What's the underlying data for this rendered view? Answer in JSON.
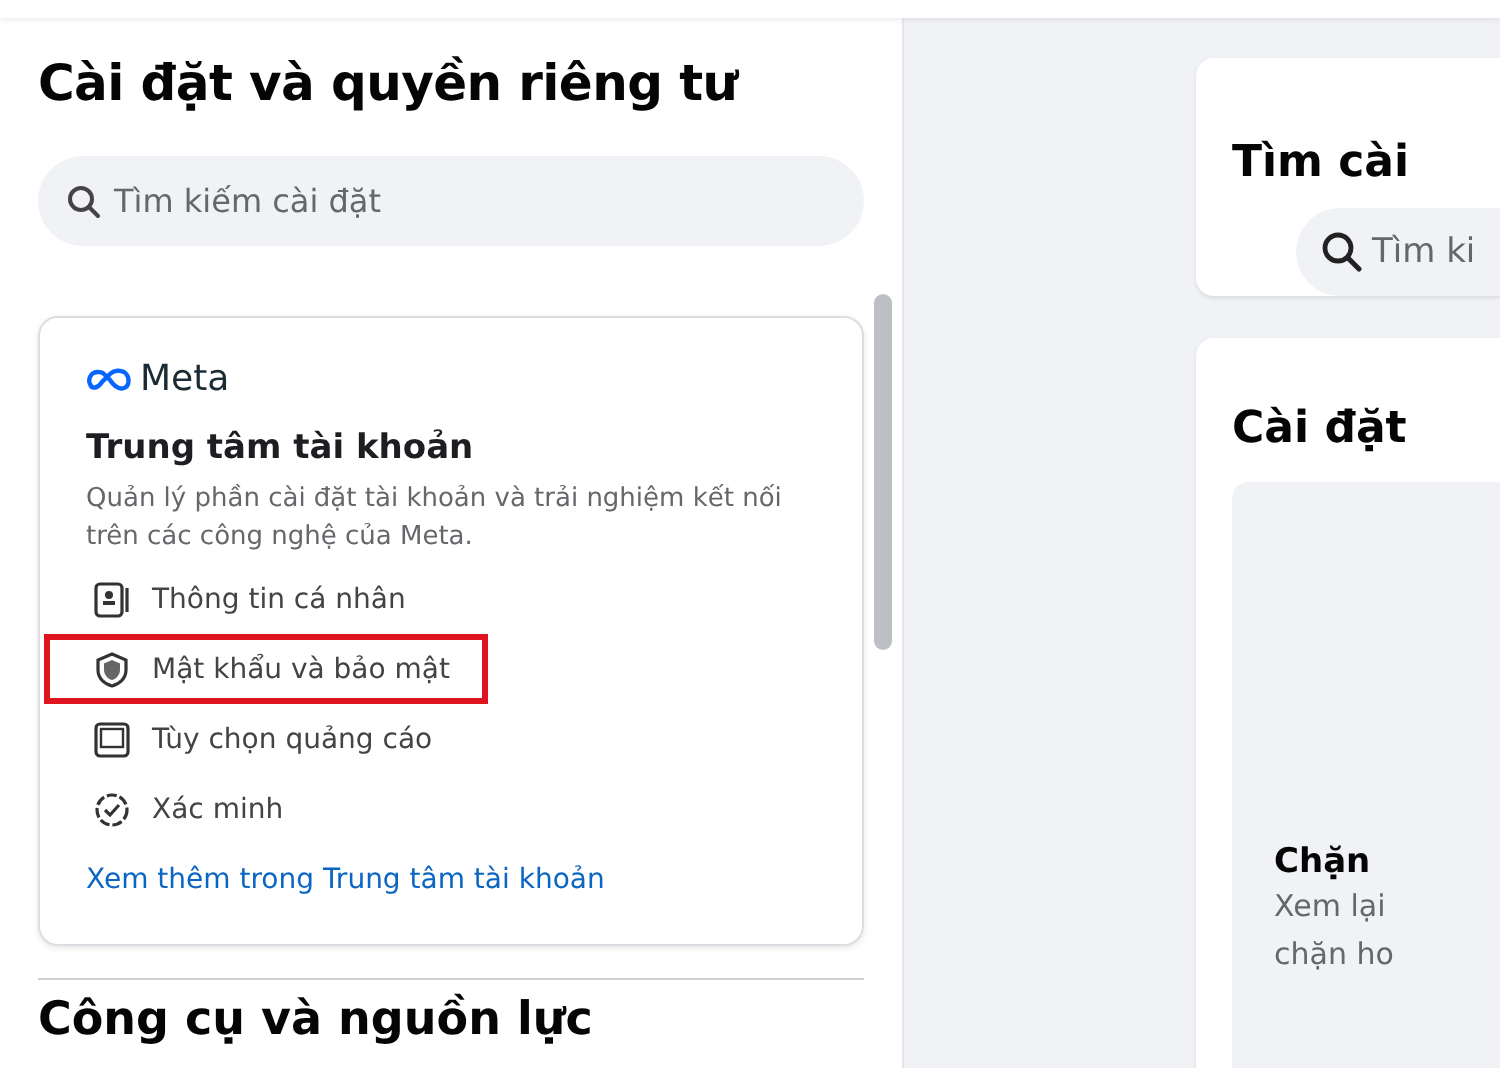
{
  "sidebar": {
    "title": "Cài đặt và quyền riêng tư",
    "search": {
      "placeholder": "Tìm kiếm cài đặt"
    },
    "accounts_card": {
      "brand": "Meta",
      "title": "Trung tâm tài khoản",
      "description": "Quản lý phần cài đặt tài khoản và trải nghiệm kết nối trên các công nghệ của Meta.",
      "items": [
        {
          "kind": "profile",
          "label": "Thông tin cá nhân",
          "highlighted": false
        },
        {
          "kind": "security",
          "label": "Mật khẩu và bảo mật",
          "highlighted": true
        },
        {
          "kind": "ads",
          "label": "Tùy chọn quảng cáo",
          "highlighted": false
        },
        {
          "kind": "verify",
          "label": "Xác minh",
          "highlighted": false
        }
      ],
      "link": "Xem thêm trong Trung tâm tài khoản"
    },
    "next_section": "Công cụ và nguồn lực"
  },
  "main": {
    "search_card": {
      "title": "Tìm cài",
      "search": {
        "placeholder": "Tìm ki"
      }
    },
    "settings_card": {
      "title": "Cài đặt",
      "tile": {
        "title": "Chặn",
        "description": [
          "Xem lại",
          "chặn ho"
        ]
      }
    }
  }
}
